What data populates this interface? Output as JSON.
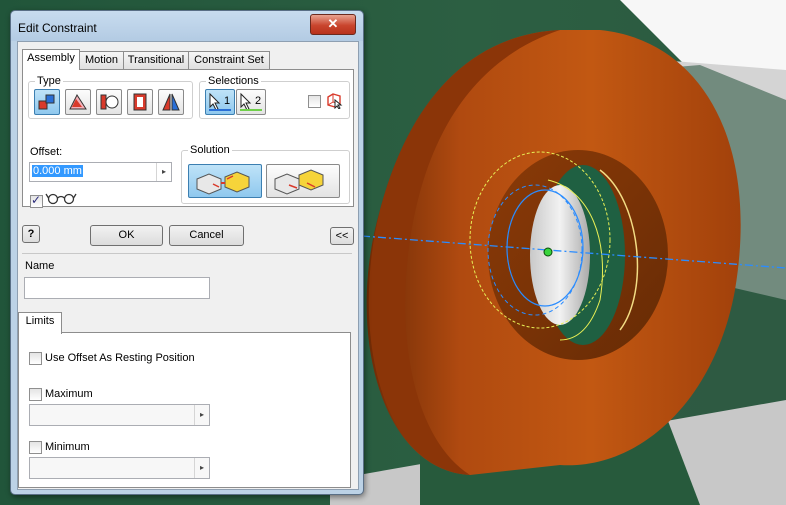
{
  "dialog": {
    "title": "Edit Constraint",
    "close_glyph": "✕",
    "tabs": [
      "Assembly",
      "Motion",
      "Transitional",
      "Constraint Set"
    ],
    "type_label": "Type",
    "selections_label": "Selections",
    "selection_1": "1",
    "selection_2": "2",
    "offset_label": "Offset:",
    "offset_value": "0.000 mm",
    "solution_label": "Solution",
    "help_glyph": "?",
    "ok_label": "OK",
    "cancel_label": "Cancel",
    "collapse_label": "<<",
    "name_label": "Name",
    "name_value": "",
    "limits_tab": "Limits",
    "use_offset_label": "Use Offset As Resting Position",
    "maximum_label": "Maximum",
    "minimum_label": "Minimum",
    "spin_glyph": "▸"
  },
  "colors": {
    "part_orange": "#b24a0e",
    "background_green": "#275a3c",
    "constraint_blue": "#2a8cff",
    "accent_yellow": "#e8ef55",
    "dialog_frame": "#bcd2e6"
  }
}
